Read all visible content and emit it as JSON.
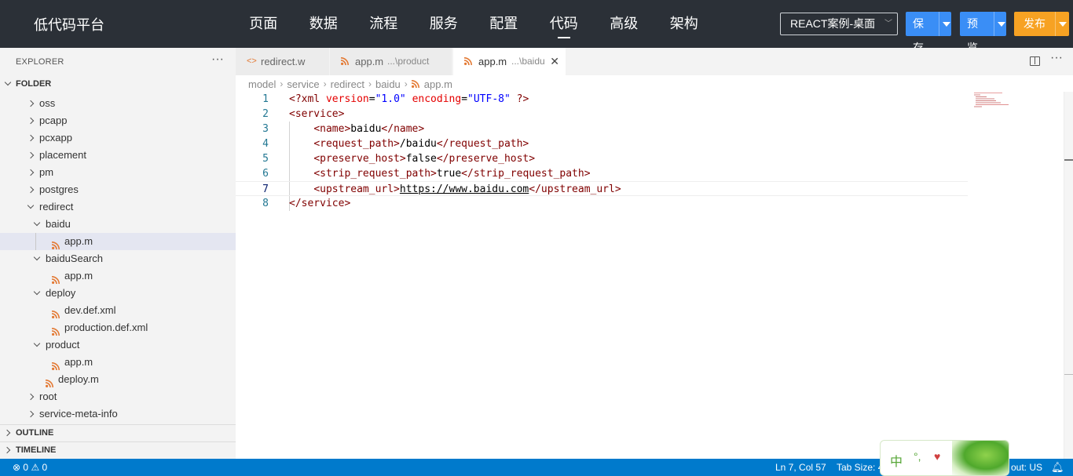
{
  "app": {
    "brand": "低代码平台"
  },
  "nav": {
    "items": [
      "页面",
      "数据",
      "流程",
      "服务",
      "配置",
      "代码",
      "高级",
      "架构"
    ],
    "active": "代码"
  },
  "toolbar": {
    "project_select": "REACT案例-桌面",
    "save": "保存",
    "preview": "预览",
    "publish": "发布"
  },
  "colors": {
    "topbar": "#2b3037",
    "primary": "#3a8ef6",
    "publish": "#f7a223",
    "statusbar": "#007acc",
    "xml_icon": "#e37933"
  },
  "explorer": {
    "title": "EXPLORER",
    "more": "···",
    "folder_header": "FOLDER",
    "tree": [
      {
        "label": "oss",
        "type": "folder",
        "expanded": false
      },
      {
        "label": "pcapp",
        "type": "folder",
        "expanded": false
      },
      {
        "label": "pcxapp",
        "type": "folder",
        "expanded": false
      },
      {
        "label": "placement",
        "type": "folder",
        "expanded": false
      },
      {
        "label": "pm",
        "type": "folder",
        "expanded": false
      },
      {
        "label": "postgres",
        "type": "folder",
        "expanded": false
      },
      {
        "label": "redirect",
        "type": "folder",
        "expanded": true
      },
      {
        "label": "baidu",
        "type": "folder",
        "expanded": true
      },
      {
        "label": "app.m",
        "type": "file",
        "selected": true
      },
      {
        "label": "baiduSearch",
        "type": "folder",
        "expanded": true
      },
      {
        "label": "app.m",
        "type": "file"
      },
      {
        "label": "deploy",
        "type": "folder",
        "expanded": true
      },
      {
        "label": "dev.def.xml",
        "type": "file"
      },
      {
        "label": "production.def.xml",
        "type": "file"
      },
      {
        "label": "product",
        "type": "folder",
        "expanded": true
      },
      {
        "label": "app.m",
        "type": "file"
      },
      {
        "label": "deploy.m",
        "type": "file"
      },
      {
        "label": "root",
        "type": "folder",
        "expanded": false
      },
      {
        "label": "service-meta-info",
        "type": "folder",
        "expanded": false
      }
    ],
    "outline": "OUTLINE",
    "timeline": "TIMELINE"
  },
  "tabs": [
    {
      "name": "redirect.w",
      "path": "",
      "icon": "code-icon",
      "active": false
    },
    {
      "name": "app.m",
      "path": "...\\product",
      "icon": "rss-icon",
      "active": false
    },
    {
      "name": "app.m",
      "path": "...\\baidu",
      "icon": "rss-icon",
      "active": true,
      "close": "✕"
    }
  ],
  "breadcrumb": [
    "model",
    "service",
    "redirect",
    "baidu",
    "app.m"
  ],
  "editor": {
    "current_line": 7,
    "lines": [
      {
        "n": "1",
        "indent": "",
        "tokens": [
          [
            "tg",
            "<?xml "
          ],
          [
            "at",
            "version"
          ],
          [
            "tx",
            "="
          ],
          [
            "av",
            "\"1.0\""
          ],
          [
            "tx",
            " "
          ],
          [
            "at",
            "encoding"
          ],
          [
            "tx",
            "="
          ],
          [
            "av",
            "\"UTF-8\""
          ],
          [
            "tx",
            " "
          ],
          [
            "tg",
            "?>"
          ]
        ]
      },
      {
        "n": "2",
        "indent": "",
        "tokens": [
          [
            "tg",
            "<service>"
          ]
        ]
      },
      {
        "n": "3",
        "indent": "    ",
        "tokens": [
          [
            "tg",
            "<name>"
          ],
          [
            "tx",
            "baidu"
          ],
          [
            "tg",
            "</name>"
          ]
        ]
      },
      {
        "n": "4",
        "indent": "    ",
        "tokens": [
          [
            "tg",
            "<request_path>"
          ],
          [
            "tx",
            "/baidu"
          ],
          [
            "tg",
            "</request_path>"
          ]
        ]
      },
      {
        "n": "5",
        "indent": "    ",
        "tokens": [
          [
            "tg",
            "<preserve_host>"
          ],
          [
            "tx",
            "false"
          ],
          [
            "tg",
            "</preserve_host>"
          ]
        ]
      },
      {
        "n": "6",
        "indent": "    ",
        "tokens": [
          [
            "tg",
            "<strip_request_path>"
          ],
          [
            "tx",
            "true"
          ],
          [
            "tg",
            "</strip_request_path>"
          ]
        ]
      },
      {
        "n": "7",
        "indent": "    ",
        "tokens": [
          [
            "tg",
            "<upstream_url>"
          ],
          [
            "url",
            "https://www.baidu.com"
          ],
          [
            "tg",
            "</upstream_url>"
          ]
        ]
      },
      {
        "n": "8",
        "indent": "",
        "tokens": [
          [
            "tg",
            "</service>"
          ]
        ]
      }
    ]
  },
  "status": {
    "errors": "0",
    "warnings": "0",
    "position": "Ln 7, Col 57",
    "tab_size": "Tab Size: 4",
    "layout": "out: US"
  },
  "ime": {
    "mode": "中",
    "punct": "°,"
  }
}
